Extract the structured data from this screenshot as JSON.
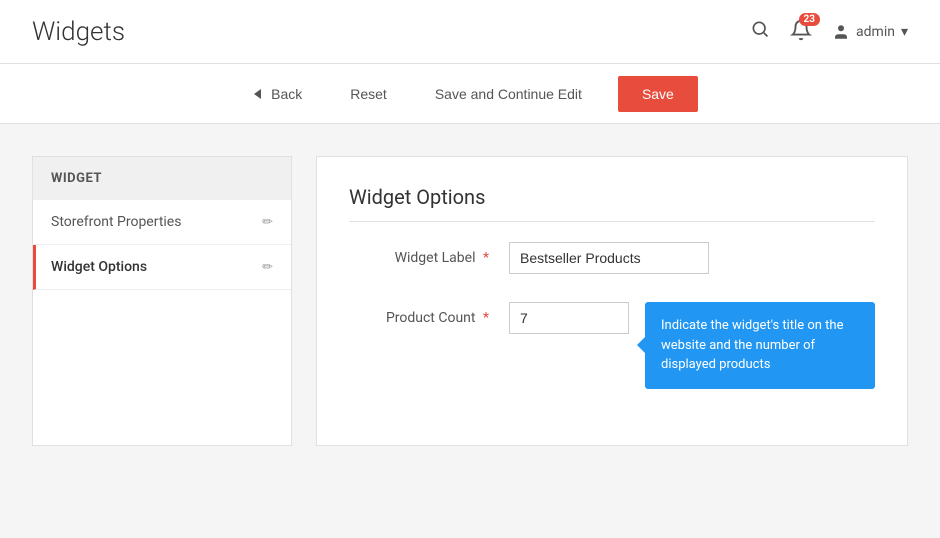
{
  "page": {
    "title": "Widgets"
  },
  "topbar": {
    "search_icon": "🔍",
    "bell_badge": "23",
    "admin_label": "admin",
    "chevron": "▾"
  },
  "action_bar": {
    "back_label": "Back",
    "reset_label": "Reset",
    "save_continue_label": "Save and Continue Edit",
    "save_label": "Save"
  },
  "sidebar": {
    "header": "WIDGET",
    "items": [
      {
        "label": "Storefront Properties",
        "active": false
      },
      {
        "label": "Widget Options",
        "active": true
      }
    ]
  },
  "panel": {
    "title": "Widget Options",
    "fields": [
      {
        "label": "Widget Label",
        "required": true,
        "value": "Bestseller Products",
        "type": "text"
      },
      {
        "label": "Product Count",
        "required": true,
        "value": "7",
        "type": "text"
      }
    ],
    "tooltip": "Indicate the widget's title on the website and the number of displayed products"
  }
}
